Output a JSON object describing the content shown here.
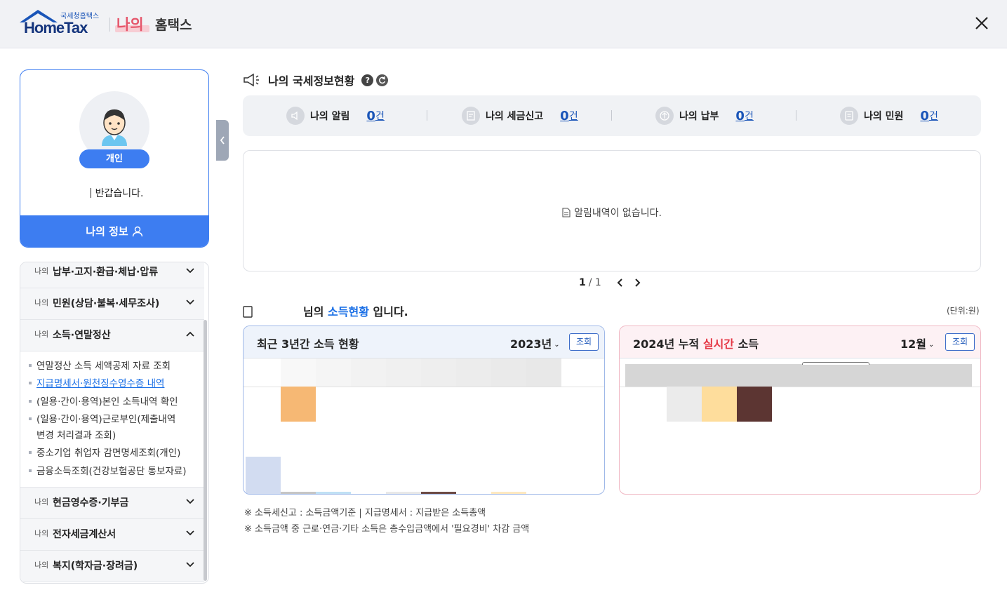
{
  "header": {
    "logo_small": "국세청홈택스",
    "logo_big": "HomeTax",
    "my_label": "나의",
    "hometax_label": "홈택스",
    "close_icon": "close-icon"
  },
  "profile": {
    "badge": "개인",
    "greeting": "반갑습니다.",
    "my_info_button": "나의 정보"
  },
  "menu": {
    "prefix": "나의",
    "items": [
      {
        "title": "납부·고지·환급·체납·압류",
        "expanded": false
      },
      {
        "title": "민원(상담·불복·세무조사)",
        "expanded": false
      },
      {
        "title": "소득·연말정산",
        "expanded": true
      },
      {
        "title": "현금영수증·기부금",
        "expanded": false
      },
      {
        "title": "전자세금계산서",
        "expanded": false
      },
      {
        "title": "복지(학자금·장려금)",
        "expanded": false
      }
    ],
    "sub_items": [
      "연말정산 소득 세액공제 자료 조회",
      "지급명세서·원천징수영수증 내역",
      "(일용·간이·용역)본인 소득내역 확인",
      "(일용·간이·용역)근로부인(제출내역",
      "변경 처리결과 조회)",
      "중소기업 취업자 감면명세조회(개인)",
      "금융소득조회(건강보험공단 통보자료)"
    ]
  },
  "status": {
    "title": "나의 국세정보현황",
    "help": "?",
    "cells": [
      {
        "label": "나의 알림",
        "count": "0",
        "unit": "건"
      },
      {
        "label": "나의 세금신고",
        "count": "0",
        "unit": "건"
      },
      {
        "label": "나의 납부",
        "count": "0",
        "unit": "건"
      },
      {
        "label": "나의 민원",
        "count": "0",
        "unit": "건"
      }
    ]
  },
  "notice": {
    "empty_text": "알림내역이 없습니다."
  },
  "pager": {
    "current": "1",
    "total": "/ 1"
  },
  "income": {
    "title_suffix": "님의",
    "title_highlight": "소득현황",
    "title_end": "입니다.",
    "unit_note": "(단위:원)",
    "left_card": {
      "title": "최근 3년간 소득 현황",
      "year": "2023년",
      "button": "조회"
    },
    "right_card": {
      "title_a": "2024년 누적",
      "title_red": "실시간",
      "title_b": "소득",
      "month": "12월",
      "button": "조회"
    }
  },
  "footnotes": [
    "※ 소득세신고 : 소득금액기준  |  지급명세서 : 지급받은 소득총액",
    "※ 소득금액 중 근로·연금·기타 소득은 총수입금액에서 '필요경비' 차감 금액"
  ]
}
